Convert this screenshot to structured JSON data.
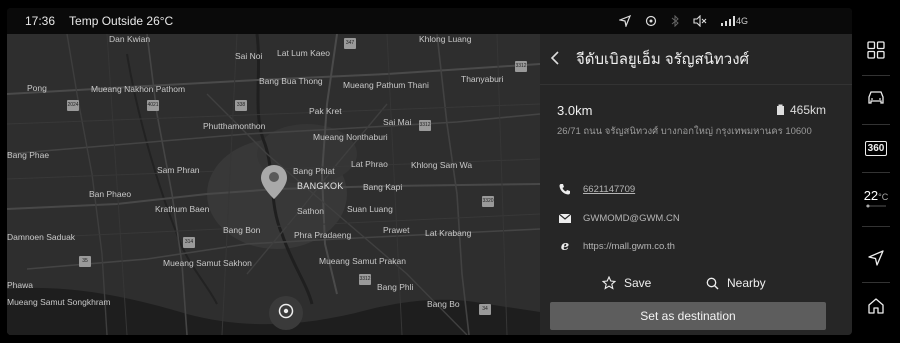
{
  "status_bar": {
    "time": "17:36",
    "outside_temp": "Temp Outside 26°C",
    "network": "4G"
  },
  "map": {
    "labels": [
      {
        "text": "Dan Kwian",
        "kind": "town"
      },
      {
        "text": "Sai Noi",
        "kind": "town"
      },
      {
        "text": "Lat Lum Kaeo",
        "kind": "town"
      },
      {
        "text": "Khlong Luang",
        "kind": "town"
      },
      {
        "text": "Pong",
        "kind": "town"
      },
      {
        "text": "Mueang Nakhon Pathom",
        "kind": "town"
      },
      {
        "text": "Bang Bua Thong",
        "kind": "town"
      },
      {
        "text": "Mueang Pathum Thani",
        "kind": "town"
      },
      {
        "text": "Thanyaburi",
        "kind": "town"
      },
      {
        "text": "Pak Kret",
        "kind": "town"
      },
      {
        "text": "Phutthamonthon",
        "kind": "town"
      },
      {
        "text": "Sai Mai",
        "kind": "town"
      },
      {
        "text": "Mueang Nonthaburi",
        "kind": "town"
      },
      {
        "text": "Bang Phae",
        "kind": "town"
      },
      {
        "text": "Sam Phran",
        "kind": "town"
      },
      {
        "text": "Bang Phlat",
        "kind": "town"
      },
      {
        "text": "Lat Phrao",
        "kind": "town"
      },
      {
        "text": "Khlong Sam Wa",
        "kind": "town"
      },
      {
        "text": "Ban Phaeo",
        "kind": "town"
      },
      {
        "text": "BANGKOK",
        "kind": "city"
      },
      {
        "text": "Bang Kapi",
        "kind": "town"
      },
      {
        "text": "Krathum Baen",
        "kind": "town"
      },
      {
        "text": "Sathon",
        "kind": "town"
      },
      {
        "text": "Suan Luang",
        "kind": "town"
      },
      {
        "text": "Bang Bon",
        "kind": "town"
      },
      {
        "text": "Phra Pradaeng",
        "kind": "town"
      },
      {
        "text": "Prawet",
        "kind": "town"
      },
      {
        "text": "Lat Krabang",
        "kind": "town"
      },
      {
        "text": "Damnoen Saduak",
        "kind": "town"
      },
      {
        "text": "Mueang Samut Sakhon",
        "kind": "town"
      },
      {
        "text": "Mueang Samut Prakan",
        "kind": "town"
      },
      {
        "text": "Bang Phli",
        "kind": "town"
      },
      {
        "text": "Bang Bo",
        "kind": "town"
      },
      {
        "text": "Phawa",
        "kind": "town"
      },
      {
        "text": "Mueang Samut Songkhram",
        "kind": "town"
      }
    ],
    "shields": [
      "347",
      "3312",
      "2024",
      "4021",
      "338",
      "3312",
      "3320",
      "35",
      "314",
      "3312",
      "34"
    ],
    "locate_icon": "crosshair-icon",
    "pin_icon": "location-pin-icon"
  },
  "poi": {
    "title": "จีดับเบิลยูเอ็ม จรัญสนิทวงศ์",
    "distance": "3.0km",
    "range": "465km",
    "address": "26/71 ถนน จรัญสนิทวงศ์ บางกอกใหญ่ กรุงเทพมหานคร 10600",
    "phone": "6621147709",
    "email": "GWMOMD@GWM.CN",
    "website": "https://mall.gwm.co.th"
  },
  "actions": {
    "save_label": "Save",
    "nearby_label": "Nearby",
    "destination_label": "Set as destination"
  },
  "dock": {
    "items": [
      "apps-grid-icon",
      "car-icon",
      "360-view-icon",
      "temperature",
      "navigation-icon",
      "home-icon"
    ],
    "view_360_label": "360",
    "temperature": "22",
    "temperature_unit": "°C"
  },
  "colors": {
    "screen_bg": "#1b1b1b",
    "panel_bg": "#262626",
    "map_bg": "#2b2b2b",
    "button_bg": "#5d5d5d",
    "text_primary": "#f0f0f0",
    "text_secondary": "#9b9b9b"
  }
}
